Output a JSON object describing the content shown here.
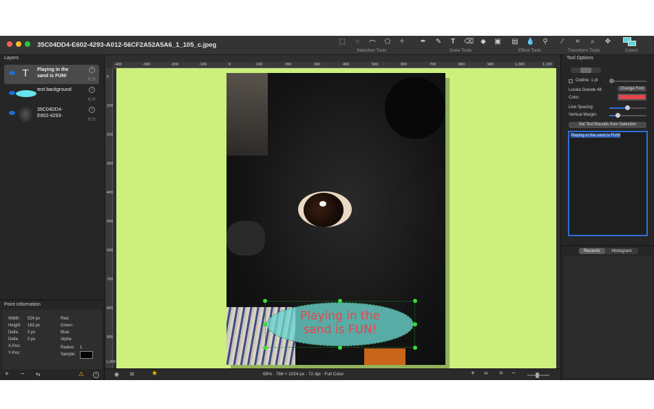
{
  "window": {
    "title": "35C04DD4-E602-4293-A012-56CF2A52A5A6_1_105_c.jpeg"
  },
  "toolbar": {
    "selection_tools_label": "Selection Tools",
    "draw_tools_label": "Draw Tools",
    "effect_tools_label": "Effect Tools",
    "transform_tools_label": "Transform Tools",
    "colors_label": "Colors"
  },
  "layers": {
    "header": "Layers",
    "items": [
      {
        "name": "Playing in the sand is FUN!",
        "line1": "Playing in the",
        "line2": "sand is FUN!"
      },
      {
        "name": "text background",
        "line1": "text background",
        "line2": ""
      },
      {
        "name": "35C04DD4-E602-4293-",
        "line1": "35C04DD4-",
        "line2": "E602-4293-"
      }
    ]
  },
  "point_info": {
    "header": "Point Information",
    "width_label": "Width:",
    "width_value": "524 px",
    "height_label": "Height",
    "height_value": "163 px",
    "delta1_label": "Delta",
    "delta1_value": "0 px",
    "delta2_label": "Delta",
    "delta2_value": "0 px",
    "xpos_label": "X-Pos:",
    "ypos_label": "Y-Pos:",
    "red_label": "Red:",
    "green_label": "Green:",
    "blue_label": "Blue:",
    "alpha_label": "Alpha:",
    "radius_label": "Radius:",
    "radius_value": "1",
    "sample_label": "Sample:"
  },
  "rulers": {
    "h": [
      "-400",
      "-300",
      "-200",
      "-100",
      "0",
      "100",
      "200",
      "300",
      "400",
      "500",
      "600",
      "700",
      "800",
      "900",
      "1,000",
      "1,100"
    ],
    "v": [
      "0",
      "100",
      "200",
      "300",
      "400",
      "500",
      "600",
      "700",
      "800",
      "900",
      "1,000"
    ]
  },
  "canvas": {
    "text_line1": "Playing in the",
    "text_line2": "sand is FUN!",
    "text_color": "#e8444c",
    "ellipse_color": "#6dd6cf",
    "background_color": "#cdf07d"
  },
  "status": {
    "info": "69% · 768 × 1024 px · 72 dpi · Full Color"
  },
  "tool_options": {
    "header": "Tool Options",
    "outline_label": "Outline: 1 pt",
    "font_label": "Lucida Grande 48",
    "change_font_button": "Change Font",
    "color_label": "Color:",
    "color_value": "#e8444c",
    "line_spacing_label": "Line Spacing:",
    "vertical_margin_label": "Vertical Margin:",
    "set_bounds_button": "Set Text Bounds from Selection",
    "text_value": "Playing in the sand is FUN!"
  },
  "bottom_tabs": {
    "recents": "Recents",
    "histogram": "Histogram"
  }
}
